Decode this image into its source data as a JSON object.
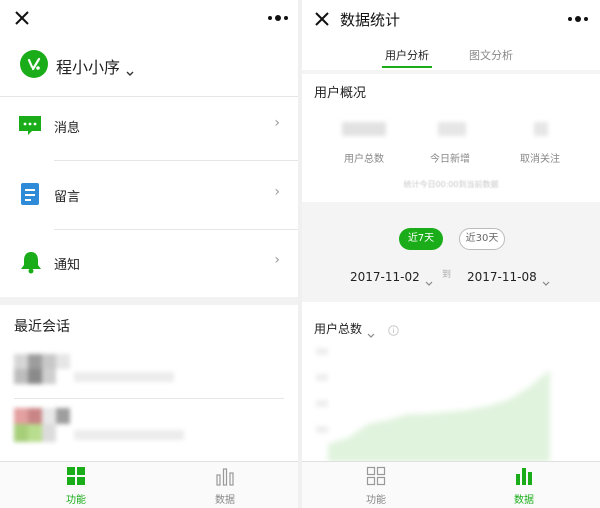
{
  "left": {
    "app_name": "程小小序",
    "menu": [
      {
        "label": "消息"
      },
      {
        "label": "留言"
      },
      {
        "label": "通知"
      }
    ],
    "recent_title": "最近会话",
    "tabs": [
      {
        "label": "功能",
        "active": true
      },
      {
        "label": "数据",
        "active": false
      }
    ]
  },
  "right": {
    "title": "数据统计",
    "subtabs": [
      {
        "label": "用户分析",
        "active": true
      },
      {
        "label": "图文分析",
        "active": false
      }
    ],
    "overview_title": "用户概况",
    "stats": [
      {
        "label": "用户总数"
      },
      {
        "label": "今日新增"
      },
      {
        "label": "取消关注"
      }
    ],
    "note": "统计今日00:00到当前数据",
    "ranges": [
      {
        "label": "近7天",
        "active": true
      },
      {
        "label": "近30天",
        "active": false
      }
    ],
    "date_start": "2017-11-02",
    "date_to": "到",
    "date_end": "2017-11-08",
    "metric_title": "用户总数",
    "tabs": [
      {
        "label": "功能",
        "active": false
      },
      {
        "label": "数据",
        "active": true
      }
    ]
  },
  "colors": {
    "accent": "#1aad19",
    "text": "#222222",
    "muted": "#999999",
    "divider": "#e6e6e6",
    "chart_fill": "#e8f6e6"
  },
  "icons": {
    "close": "close-icon",
    "more": "more-dots-icon",
    "logo": "app-logo-icon",
    "message": "message-icon",
    "comment": "comment-icon",
    "notice": "bell-icon",
    "chevron": "chevron-right-icon",
    "function_tab": "grid-icon",
    "data_tab": "bar-chart-icon",
    "info": "info-icon"
  }
}
